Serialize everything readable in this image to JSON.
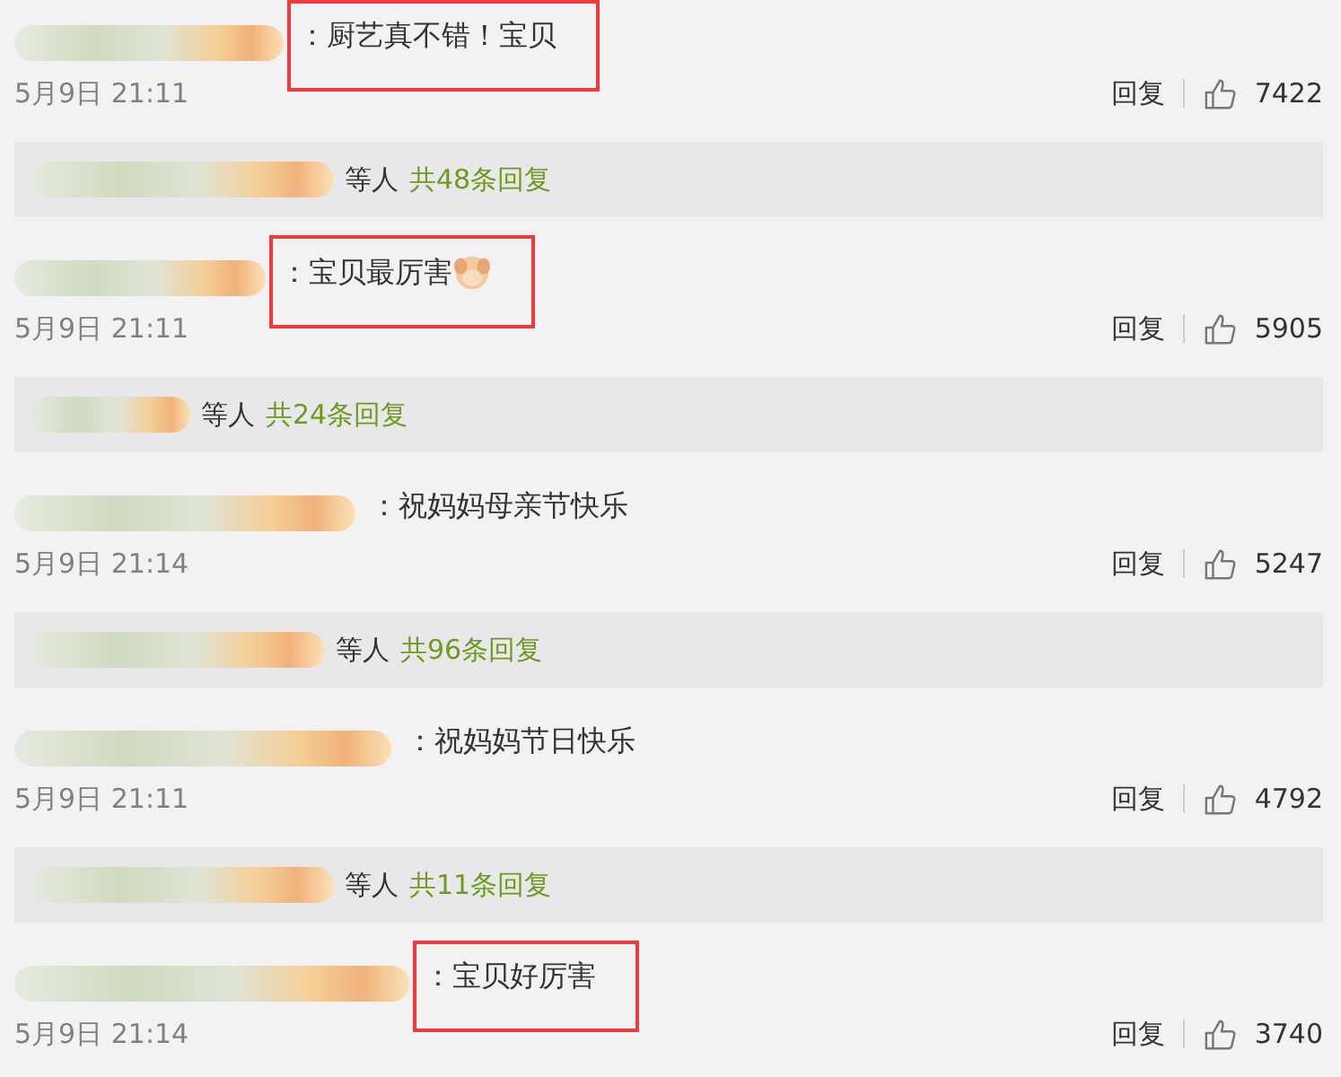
{
  "comments": [
    {
      "text": "：厨艺真不错！宝贝",
      "highlighted": true,
      "time": "5月9日 21:11",
      "reply_label": "回复",
      "likes": "7422",
      "preview": {
        "suffix": "等人",
        "count": "共48条回复"
      }
    },
    {
      "text": "：宝贝最厉害",
      "highlighted": true,
      "sticker": true,
      "time": "5月9日 21:11",
      "reply_label": "回复",
      "likes": "5905",
      "preview": {
        "suffix": "等人",
        "count": "共24条回复"
      }
    },
    {
      "text": "：祝妈妈母亲节快乐",
      "highlighted": false,
      "time": "5月9日 21:14",
      "reply_label": "回复",
      "likes": "5247",
      "preview": {
        "suffix": "等人",
        "count": "共96条回复"
      }
    },
    {
      "text": "：祝妈妈节日快乐",
      "highlighted": false,
      "time": "5月9日 21:11",
      "reply_label": "回复",
      "likes": "4792",
      "preview": {
        "suffix": "等人",
        "count": "共11条回复"
      }
    },
    {
      "text": "：宝贝好厉害",
      "highlighted": true,
      "time": "5月9日 21:14",
      "reply_label": "回复",
      "likes": "3740"
    }
  ]
}
